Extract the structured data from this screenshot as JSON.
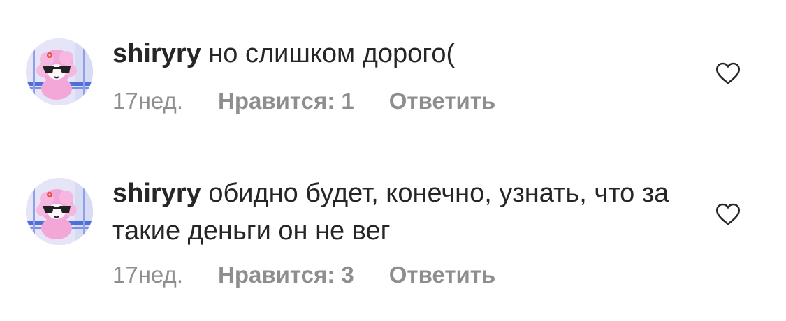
{
  "comments": [
    {
      "username": "shiryry",
      "text": "но слишком дорого(",
      "time": "17нед.",
      "likes": "Нравится: 1",
      "reply": "Ответить",
      "icon": "heart-outline-icon"
    },
    {
      "username": "shiryry",
      "text": "обидно будет, конечно, узнать, что за такие деньги он не вег",
      "time": "17нед.",
      "likes": "Нравится: 3",
      "reply": "Ответить",
      "icon": "heart-outline-icon"
    }
  ],
  "colors": {
    "text": "#262626",
    "secondary": "#8e8e8e",
    "background": "#ffffff",
    "avatar_bg": "#e8e6f6",
    "avatar_character": "#f3a6d8"
  }
}
